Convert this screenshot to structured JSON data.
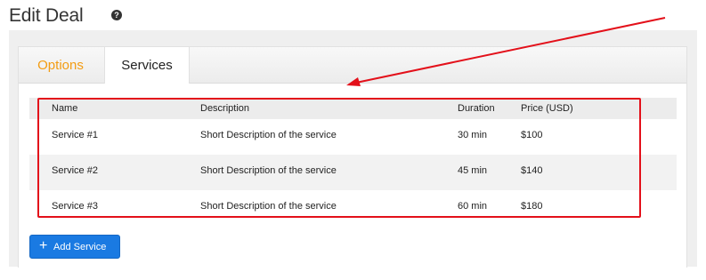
{
  "page": {
    "title": "Edit Deal",
    "help_icon": "question-circle-icon"
  },
  "tabs": [
    {
      "label": "Options",
      "active": false
    },
    {
      "label": "Services",
      "active": true
    }
  ],
  "services_table": {
    "columns": [
      "Name",
      "Description",
      "Duration",
      "Price (USD)"
    ],
    "rows": [
      {
        "name": "Service #1",
        "description": "Short Description of the service",
        "duration": "30 min",
        "price": "$100"
      },
      {
        "name": "Service #2",
        "description": "Short Description of the service",
        "duration": "45 min",
        "price": "$140"
      },
      {
        "name": "Service #3",
        "description": "Short Description of the service",
        "duration": "60 min",
        "price": "$180"
      }
    ]
  },
  "add_service_button": {
    "label": "Add Service",
    "icon": "plus-icon"
  },
  "colors": {
    "accent_orange": "#f39c12",
    "primary_blue": "#1a7ae2",
    "annotation_red": "#e3101a"
  }
}
